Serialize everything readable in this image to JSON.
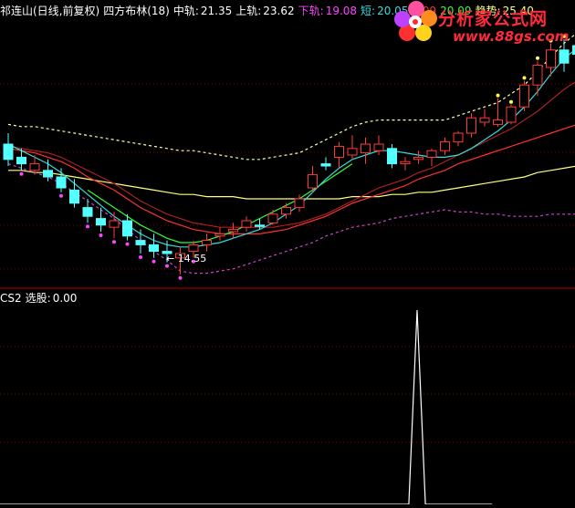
{
  "main_header": {
    "stock": "祁连山(日线,前复权)",
    "indicator": "四方布林(18)",
    "mid_label": "中轨:",
    "mid_value": "21.35",
    "upper_label": "上轨:",
    "upper_value": "23.62",
    "lower_label": "下轨:",
    "lower_value": "19.08",
    "short_label": "短:",
    "short_value": "20.05",
    "v2": "0.09",
    "v3": "20.09",
    "trend_label": "趋势:",
    "trend_value": "25.40"
  },
  "sub_header": {
    "name": "CS2",
    "label": "选股:",
    "value": "0.00"
  },
  "low_annotation": "14.55",
  "watermark": {
    "title": "分析家公式网",
    "url": "www.88gs.com"
  },
  "colors": {
    "bg": "#000000",
    "up": "#ff3b3b",
    "down": "#54ffff",
    "upper_band": "#ffffaa",
    "lower_band": "#cc44cc",
    "mid_line": "#ff3030",
    "short_line": "#33dddd",
    "trend_line": "#ffff80",
    "dark_red": "#aa2020",
    "green_line": "#33ff33",
    "grid": "#800000",
    "signal": "#ffffff"
  },
  "chart_data": [
    {
      "type": "candlestick",
      "price_range": [
        14,
        26
      ],
      "candles": [
        {
          "o": 20.5,
          "h": 21.0,
          "l": 19.5,
          "c": 19.8,
          "d": "down"
        },
        {
          "o": 19.9,
          "h": 20.3,
          "l": 19.3,
          "c": 19.6,
          "d": "down"
        },
        {
          "o": 19.6,
          "h": 20.0,
          "l": 19.1,
          "c": 19.3,
          "d": "up"
        },
        {
          "o": 19.3,
          "h": 19.8,
          "l": 18.8,
          "c": 19.0,
          "d": "down"
        },
        {
          "o": 19.0,
          "h": 19.4,
          "l": 18.3,
          "c": 18.5,
          "d": "down"
        },
        {
          "o": 18.4,
          "h": 18.9,
          "l": 17.6,
          "c": 17.8,
          "d": "down"
        },
        {
          "o": 17.6,
          "h": 18.0,
          "l": 16.9,
          "c": 17.2,
          "d": "down"
        },
        {
          "o": 17.1,
          "h": 17.6,
          "l": 16.5,
          "c": 16.8,
          "d": "down"
        },
        {
          "o": 16.7,
          "h": 17.4,
          "l": 16.2,
          "c": 17.0,
          "d": "up"
        },
        {
          "o": 17.0,
          "h": 17.3,
          "l": 16.1,
          "c": 16.3,
          "d": "down"
        },
        {
          "o": 16.1,
          "h": 16.6,
          "l": 15.5,
          "c": 15.9,
          "d": "down"
        },
        {
          "o": 15.9,
          "h": 16.4,
          "l": 15.3,
          "c": 15.6,
          "d": "down"
        },
        {
          "o": 15.6,
          "h": 16.1,
          "l": 15.1,
          "c": 15.5,
          "d": "down"
        },
        {
          "o": 15.3,
          "h": 15.8,
          "l": 14.55,
          "c": 15.5,
          "d": "up"
        },
        {
          "o": 15.6,
          "h": 16.1,
          "l": 15.3,
          "c": 15.9,
          "d": "up"
        },
        {
          "o": 15.9,
          "h": 16.4,
          "l": 15.6,
          "c": 16.1,
          "d": "up"
        },
        {
          "o": 16.3,
          "h": 16.7,
          "l": 16.1,
          "c": 16.4,
          "d": "up"
        },
        {
          "o": 16.5,
          "h": 16.9,
          "l": 16.2,
          "c": 16.6,
          "d": "up"
        },
        {
          "o": 16.7,
          "h": 17.2,
          "l": 16.5,
          "c": 17.0,
          "d": "up"
        },
        {
          "o": 16.8,
          "h": 17.1,
          "l": 16.6,
          "c": 16.8,
          "d": "down"
        },
        {
          "o": 16.9,
          "h": 17.5,
          "l": 16.8,
          "c": 17.3,
          "d": "up"
        },
        {
          "o": 17.3,
          "h": 17.8,
          "l": 17.1,
          "c": 17.6,
          "d": "up"
        },
        {
          "o": 17.6,
          "h": 18.2,
          "l": 17.4,
          "c": 18.0,
          "d": "up"
        },
        {
          "o": 18.5,
          "h": 19.5,
          "l": 18.3,
          "c": 19.1,
          "d": "up"
        },
        {
          "o": 19.5,
          "h": 19.9,
          "l": 19.3,
          "c": 19.6,
          "d": "down"
        },
        {
          "o": 19.9,
          "h": 20.6,
          "l": 19.4,
          "c": 20.4,
          "d": "up"
        },
        {
          "o": 20.3,
          "h": 20.9,
          "l": 19.8,
          "c": 20.0,
          "d": "up"
        },
        {
          "o": 20.1,
          "h": 20.8,
          "l": 19.6,
          "c": 20.5,
          "d": "up"
        },
        {
          "o": 20.5,
          "h": 20.9,
          "l": 20.0,
          "c": 20.2,
          "d": "up"
        },
        {
          "o": 20.3,
          "h": 20.5,
          "l": 19.4,
          "c": 19.6,
          "d": "down"
        },
        {
          "o": 19.6,
          "h": 19.9,
          "l": 19.3,
          "c": 19.7,
          "d": "up"
        },
        {
          "o": 19.8,
          "h": 20.2,
          "l": 19.6,
          "c": 19.9,
          "d": "up"
        },
        {
          "o": 19.9,
          "h": 20.3,
          "l": 19.5,
          "c": 20.2,
          "d": "up"
        },
        {
          "o": 20.2,
          "h": 20.8,
          "l": 20.0,
          "c": 20.6,
          "d": "up"
        },
        {
          "o": 20.6,
          "h": 21.1,
          "l": 20.4,
          "c": 21.0,
          "d": "up"
        },
        {
          "o": 21.0,
          "h": 21.9,
          "l": 20.8,
          "c": 21.7,
          "d": "up"
        },
        {
          "o": 21.7,
          "h": 22.1,
          "l": 21.3,
          "c": 21.5,
          "d": "up"
        },
        {
          "o": 21.6,
          "h": 22.6,
          "l": 21.3,
          "c": 21.4,
          "d": "up"
        },
        {
          "o": 21.5,
          "h": 22.3,
          "l": 21.4,
          "c": 22.2,
          "d": "up"
        },
        {
          "o": 22.2,
          "h": 23.4,
          "l": 22.0,
          "c": 23.2,
          "d": "up"
        },
        {
          "o": 23.2,
          "h": 24.3,
          "l": 22.7,
          "c": 24.1,
          "d": "up"
        },
        {
          "o": 24.0,
          "h": 25.1,
          "l": 23.6,
          "c": 24.8,
          "d": "up"
        },
        {
          "o": 24.8,
          "h": 25.3,
          "l": 23.8,
          "c": 24.2,
          "d": "down"
        },
        {
          "o": 24.6,
          "h": 25.6,
          "l": 24.1,
          "c": 25.0,
          "d": "down"
        }
      ],
      "upper_band": [
        21.4,
        21.3,
        21.3,
        21.2,
        21.1,
        21.0,
        20.9,
        20.8,
        20.7,
        20.6,
        20.5,
        20.4,
        20.3,
        20.2,
        20.2,
        20.1,
        20.0,
        19.9,
        19.8,
        19.8,
        19.9,
        20.0,
        20.1,
        20.4,
        20.7,
        21.0,
        21.3,
        21.5,
        21.6,
        21.6,
        21.6,
        21.6,
        21.6,
        21.6,
        21.8,
        22.0,
        22.2,
        22.4,
        22.8,
        23.2,
        23.8,
        24.5,
        25.1,
        25.6
      ],
      "lower_band": [
        19.6,
        19.4,
        19.2,
        19.0,
        18.7,
        18.3,
        17.9,
        17.5,
        17.1,
        16.6,
        16.1,
        15.6,
        15.2,
        14.7,
        14.6,
        14.6,
        14.7,
        14.8,
        15.0,
        15.2,
        15.4,
        15.6,
        15.8,
        16.0,
        16.3,
        16.5,
        16.7,
        16.8,
        16.9,
        17.1,
        17.2,
        17.3,
        17.4,
        17.5,
        17.4,
        17.4,
        17.3,
        17.3,
        17.2,
        17.2,
        17.2,
        17.3,
        17.3,
        17.3
      ],
      "mid_line": [
        20.3,
        20.2,
        20.1,
        19.9,
        19.7,
        19.4,
        19.0,
        18.7,
        18.4,
        18.0,
        17.6,
        17.3,
        17.0,
        16.8,
        16.6,
        16.5,
        16.4,
        16.4,
        16.4,
        16.4,
        16.5,
        16.6,
        16.8,
        17.0,
        17.2,
        17.5,
        17.8,
        18.0,
        18.2,
        18.4,
        18.6,
        18.9,
        19.1,
        19.3,
        19.6,
        19.8,
        20.0,
        20.2,
        20.4,
        20.6,
        20.8,
        21.0,
        21.2,
        21.4
      ],
      "short_line": [
        20.5,
        20.2,
        19.9,
        19.6,
        19.2,
        18.7,
        18.2,
        17.7,
        17.2,
        16.8,
        16.4,
        16.1,
        15.9,
        15.8,
        15.8,
        15.9,
        16.0,
        16.2,
        16.4,
        16.6,
        16.9,
        17.3,
        17.7,
        18.3,
        18.9,
        19.4,
        19.8,
        20.0,
        20.2,
        20.2,
        20.1,
        20.0,
        19.9,
        19.9,
        20.0,
        20.3,
        20.7,
        21.1,
        21.6,
        22.2,
        22.9,
        23.7,
        24.4,
        24.9
      ],
      "trend_line": [
        19.3,
        19.3,
        19.2,
        19.2,
        19.1,
        19.0,
        18.9,
        18.8,
        18.7,
        18.6,
        18.5,
        18.4,
        18.3,
        18.2,
        18.2,
        18.1,
        18.1,
        18.1,
        18.0,
        18.0,
        18.0,
        18.0,
        18.0,
        18.0,
        18.0,
        18.0,
        18.1,
        18.1,
        18.1,
        18.2,
        18.2,
        18.3,
        18.3,
        18.4,
        18.5,
        18.6,
        18.7,
        18.8,
        18.9,
        19.0,
        19.2,
        19.3,
        19.4,
        19.5
      ],
      "dark_red_line": [
        20.4,
        20.3,
        20.2,
        20.1,
        19.9,
        19.6,
        19.3,
        19.0,
        18.7,
        18.3,
        17.9,
        17.6,
        17.3,
        17.1,
        16.9,
        16.8,
        16.7,
        16.7,
        16.7,
        16.7,
        16.7,
        16.8,
        16.9,
        17.1,
        17.3,
        17.6,
        17.9,
        18.2,
        18.5,
        18.7,
        18.9,
        19.2,
        19.4,
        19.7,
        20.0,
        20.3,
        20.6,
        20.9,
        21.2,
        21.6,
        22.0,
        22.5,
        23.0,
        23.4
      ],
      "green_line": [
        null,
        null,
        null,
        null,
        null,
        null,
        18.4,
        18.0,
        17.6,
        17.2,
        16.8,
        16.5,
        16.2,
        16.0,
        16.0,
        16.1,
        16.3,
        16.5,
        16.8,
        17.1,
        17.4,
        17.7,
        18.0,
        18.4,
        18.8,
        19.2,
        19.6
      ]
    },
    {
      "type": "line",
      "series": [
        {
          "name": "选股",
          "values": [
            0,
            0,
            0,
            0,
            0,
            0,
            0,
            0,
            0,
            0,
            0,
            0,
            0,
            0,
            0,
            0,
            0,
            0,
            0,
            0,
            0,
            0,
            0,
            0,
            0,
            0,
            0,
            0,
            0,
            0,
            0,
            0,
            0,
            0,
            0,
            0,
            0,
            0,
            0,
            0,
            0,
            0,
            0,
            0,
            0,
            0,
            0,
            0,
            0,
            0,
            0,
            0,
            0,
            0,
            0,
            0,
            0,
            0,
            0,
            0,
            1,
            0,
            0,
            0,
            0,
            0,
            0,
            0,
            0,
            0
          ]
        }
      ],
      "ylim": [
        0,
        1
      ]
    }
  ]
}
